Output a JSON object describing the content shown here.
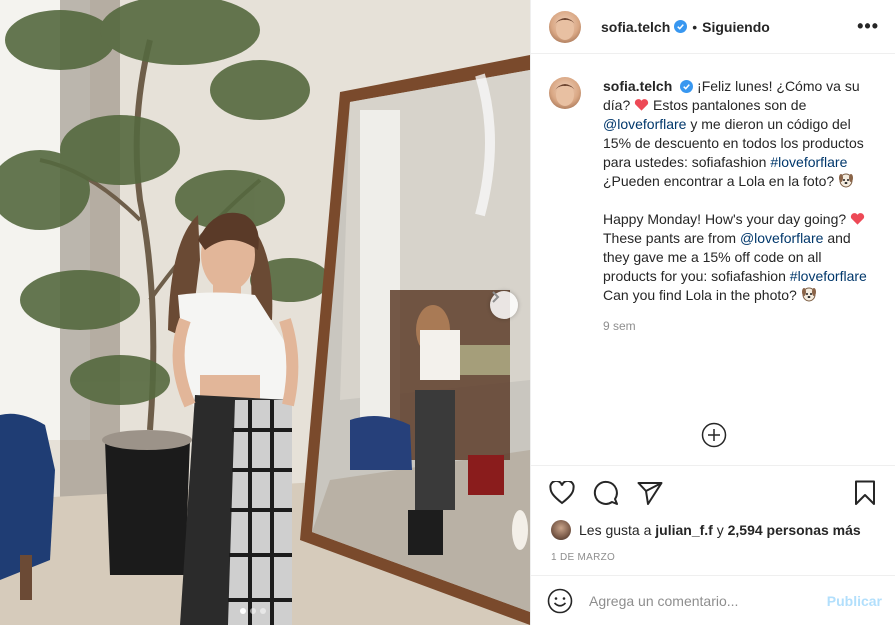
{
  "post": {
    "username": "sofia.telch",
    "verified": true,
    "separator": "•",
    "follow_status": "Siguiendo",
    "more_icon": "more-horizontal-icon"
  },
  "caption": {
    "username": "sofia.telch",
    "text_1": "¡Feliz lunes! ¿Cómo va su día?",
    "text_2": "Estos pantalones son de",
    "mention": "@loveforflare",
    "text_3": "y me dieron un código del 15% de descuento en todos los productos para ustedes: sofiafashion",
    "hashtag": "#loveforflare",
    "text_4": "¿Pueden encontrar a Lola en la foto?",
    "en_1": "Happy Monday! How's your day going?",
    "en_2": "These pants are from",
    "en_mention": "@loveforflare",
    "en_3": "and they gave me a 15% off code on all products for you: sofiafashion",
    "en_hashtag": "#loveforflare",
    "en_4": "Can you find Lola in the photo?",
    "time_ago": "9 sem"
  },
  "actions": {
    "like_icon": "heart-icon",
    "comment_icon": "comment-icon",
    "share_icon": "send-icon",
    "save_icon": "bookmark-icon",
    "likes_prefix": "Les gusta a",
    "likes_user": "julian_f.f",
    "likes_and": "y",
    "likes_count": "2,594 personas más",
    "date": "1 de marzo"
  },
  "add_comment": {
    "placeholder": "Agrega un comentario...",
    "publish_label": "Publicar"
  },
  "carousel": {
    "current": 1,
    "total": 3
  },
  "colors": {
    "link": "#00376b",
    "verified": "#3897f0",
    "heart": "#ed4956",
    "publish_disabled": "#b2dffc",
    "muted": "#8e8e8e"
  }
}
